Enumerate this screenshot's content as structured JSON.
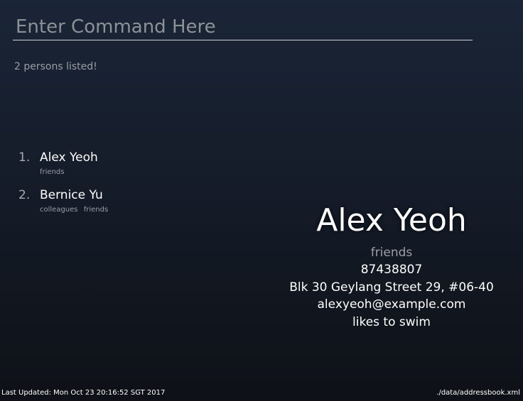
{
  "command": {
    "placeholder": "Enter Command Here",
    "value": ""
  },
  "result": {
    "text": "2 persons listed!"
  },
  "persons": [
    {
      "index": "1.",
      "name": "Alex Yeoh",
      "tags": [
        "friends"
      ]
    },
    {
      "index": "2.",
      "name": "Bernice Yu",
      "tags": [
        "colleagues",
        "friends"
      ]
    }
  ],
  "detail": {
    "name": "Alex Yeoh",
    "tags": "friends",
    "phone": "87438807",
    "address": "Blk 30 Geylang Street 29, #06-40",
    "email": "alexyeoh@example.com",
    "remark": "likes to swim"
  },
  "status": {
    "last_updated": "Last Updated: Mon Oct 23 20:16:52 SGT 2017",
    "file_path": "./data/addressbook.xml"
  }
}
